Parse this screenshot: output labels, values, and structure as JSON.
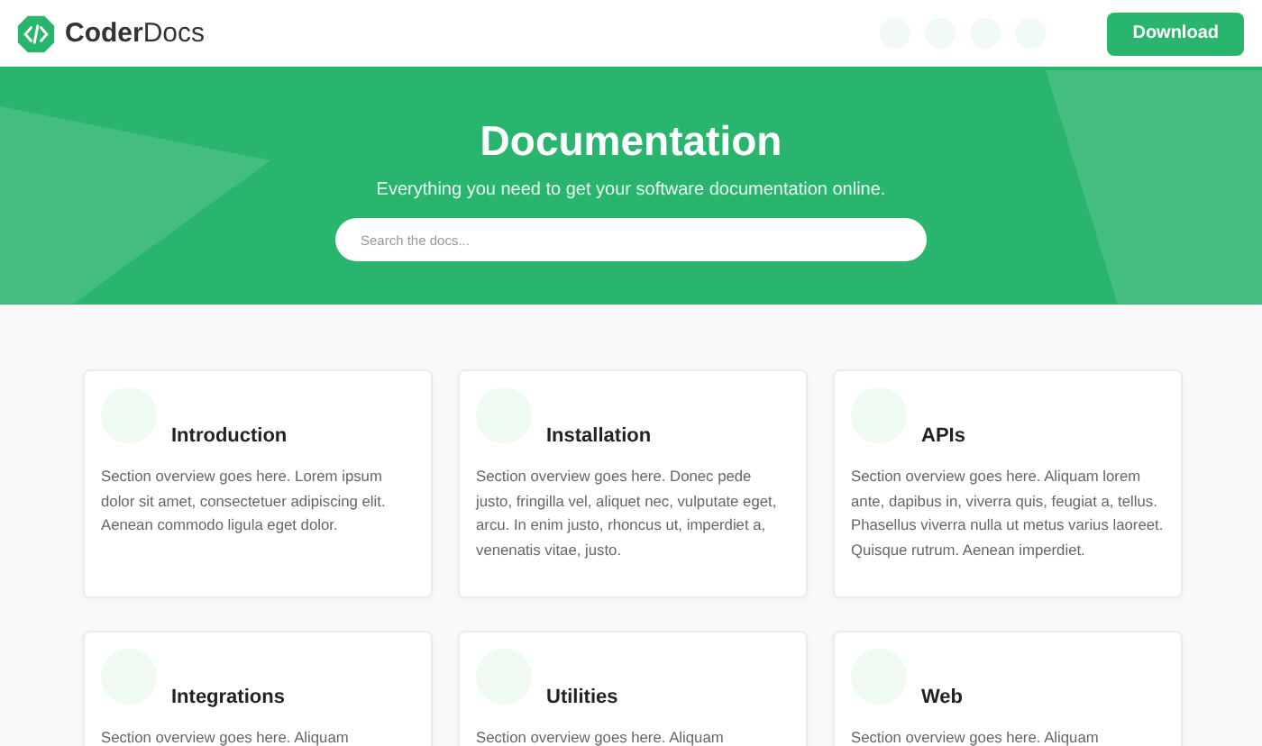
{
  "header": {
    "logo_bold": "Coder",
    "logo_light": "Docs",
    "button": "Download"
  },
  "hero": {
    "title": "Documentation",
    "subtitle": "Everything you need to get your software documentation online.",
    "search": {
      "placeholder": "Search the docs..."
    }
  },
  "cards": [
    {
      "title": "Introduction",
      "text": "Section overview goes here. Lorem ipsum dolor sit amet, consectetuer adipiscing elit. Aenean commodo ligula eget dolor."
    },
    {
      "title": "Installation",
      "text": "Section overview goes here. Donec pede justo, fringilla vel, aliquet nec, vulputate eget, arcu. In enim justo, rhoncus ut, imperdiet a, venenatis vitae, justo."
    },
    {
      "title": "APIs",
      "text": "Section overview goes here. Aliquam lorem ante, dapibus in, viverra quis, feugiat a, tellus. Phasellus viverra nulla ut metus varius laoreet. Quisque rutrum. Aenean imperdiet."
    },
    {
      "title": "Integrations",
      "text": "Section overview goes here. Aliquam"
    },
    {
      "title": "Utilities",
      "text": "Section overview goes here. Aliquam"
    },
    {
      "title": "Web",
      "text": "Section overview goes here. Aliquam"
    }
  ]
}
